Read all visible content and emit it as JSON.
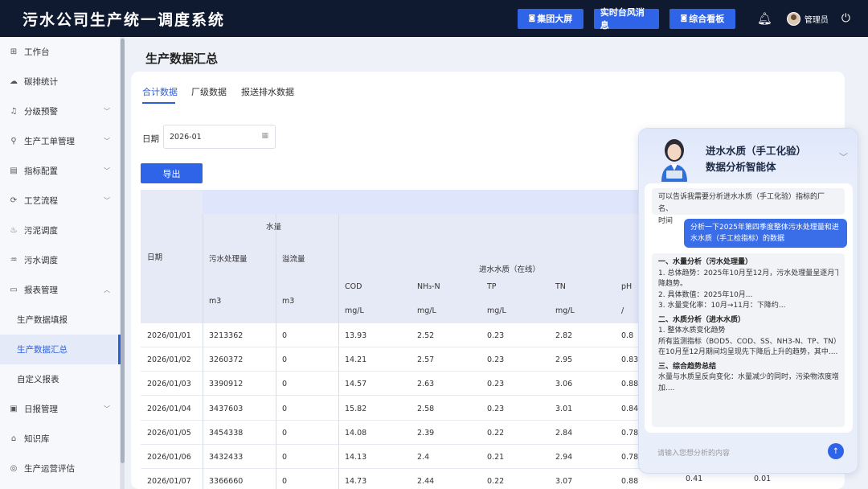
{
  "app": {
    "title": "污水公司生产统一调度系统"
  },
  "header": {
    "buttons": [
      {
        "label": "集团大屏",
        "icon": "monitor-icon"
      },
      {
        "label": "实时台风消息",
        "icon": ""
      },
      {
        "label": "综合看板",
        "icon": "monitor-icon"
      }
    ],
    "user": "管理员"
  },
  "sidebar": {
    "items": [
      {
        "label": "工作台",
        "icon": "grid-icon"
      },
      {
        "label": "碳排统计",
        "icon": "cloud-icon"
      },
      {
        "label": "分级预警",
        "icon": "bell-icon",
        "expandable": true
      },
      {
        "label": "生产工单管理",
        "icon": "org-icon",
        "expandable": true
      },
      {
        "label": "指标配置",
        "icon": "chart-icon",
        "expandable": true
      },
      {
        "label": "工艺流程",
        "icon": "flow-icon",
        "expandable": true
      },
      {
        "label": "污泥调度",
        "icon": "sludge-icon"
      },
      {
        "label": "污水调度",
        "icon": "water-icon"
      },
      {
        "label": "报表管理",
        "icon": "report-icon",
        "expandable": true,
        "expanded": true
      },
      {
        "label": "生产数据填报",
        "sub": true
      },
      {
        "label": "生产数据汇总",
        "sub": true,
        "active": true
      },
      {
        "label": "自定义报表",
        "sub": true
      },
      {
        "label": "日报管理",
        "icon": "daily-icon",
        "expandable": true
      },
      {
        "label": "知识库",
        "icon": "knowledge-icon"
      },
      {
        "label": "生产运营评估",
        "icon": "eval-icon"
      }
    ]
  },
  "page": {
    "title": "生产数据汇总",
    "tabs": [
      "合计数据",
      "厂级数据",
      "报送排水数据"
    ],
    "active_tab": 0,
    "date_label": "日期",
    "date_value": "2026-01",
    "export_label": "导出"
  },
  "table": {
    "date_header": "日期",
    "group_water": "水量",
    "group_quality": "进水水质（在线）",
    "water_cols": [
      {
        "name": "污水处理量",
        "unit": "m3"
      },
      {
        "name": "溢流量",
        "unit": "m3"
      }
    ],
    "quality_cols": [
      {
        "name": "COD",
        "unit": "mg/L"
      },
      {
        "name": "NH₃-N",
        "unit": "mg/L"
      },
      {
        "name": "TP",
        "unit": "mg/L"
      },
      {
        "name": "TN",
        "unit": "mg/L"
      },
      {
        "name": "pH",
        "unit": "/"
      }
    ],
    "rows": [
      [
        "2026/01/01",
        "3213362",
        "0",
        "13.93",
        "2.52",
        "0.23",
        "2.82",
        "0.8"
      ],
      [
        "2026/01/02",
        "3260372",
        "0",
        "14.21",
        "2.57",
        "0.23",
        "2.95",
        "0.83"
      ],
      [
        "2026/01/03",
        "3390912",
        "0",
        "14.57",
        "2.63",
        "0.23",
        "3.06",
        "0.88"
      ],
      [
        "2026/01/04",
        "3437603",
        "0",
        "15.82",
        "2.58",
        "0.23",
        "3.01",
        "0.84"
      ],
      [
        "2026/01/05",
        "3454338",
        "0",
        "14.08",
        "2.39",
        "0.22",
        "2.84",
        "0.78"
      ],
      [
        "2026/01/06",
        "3432433",
        "0",
        "14.13",
        "2.4",
        "0.21",
        "2.94",
        "0.78"
      ],
      [
        "2026/01/07",
        "3366660",
        "0",
        "14.73",
        "2.44",
        "0.22",
        "3.07",
        "0.88"
      ]
    ],
    "row7_extra": [
      "0.41",
      "0.01"
    ]
  },
  "chat": {
    "title_line1": "进水水质（手工化验）",
    "title_line2": "数据分析智能体",
    "agent_prompt": [
      "可以告诉我需要分析进水水质（手工化验）指标的厂名、",
      "时间"
    ],
    "user_msg": [
      "分析一下2025年第四季度整体污水处理量和进",
      "水水质（手工检指标）的数据"
    ],
    "reply": [
      {
        "t": "一、水量分析（污水处理量）",
        "b": true
      },
      {
        "t": "1. 总体趋势：2025年10月至12月，污水处理量呈逐月下"
      },
      {
        "t": "降趋势。"
      },
      {
        "t": "2. 具体数值：2025年10月..."
      },
      {
        "t": "3. 水量变化率：10月→11月：下降约..."
      },
      {
        "t": "二、水质分析（进水水质）",
        "b": true
      },
      {
        "t": "1. 整体水质变化趋势"
      },
      {
        "t": "所有监测指标（BOD5、COD、SS、NH3-N、TP、TN）"
      },
      {
        "t": "在10月至12月期间均呈现先下降后上升的趋势，其中...."
      },
      {
        "t": "三、综合趋势总结",
        "b": true
      },
      {
        "t": "水量与水质呈反向变化：水量减少的同时，污染物浓度增"
      },
      {
        "t": "加...."
      }
    ],
    "input_placeholder": "请输入您想分析的内容"
  }
}
